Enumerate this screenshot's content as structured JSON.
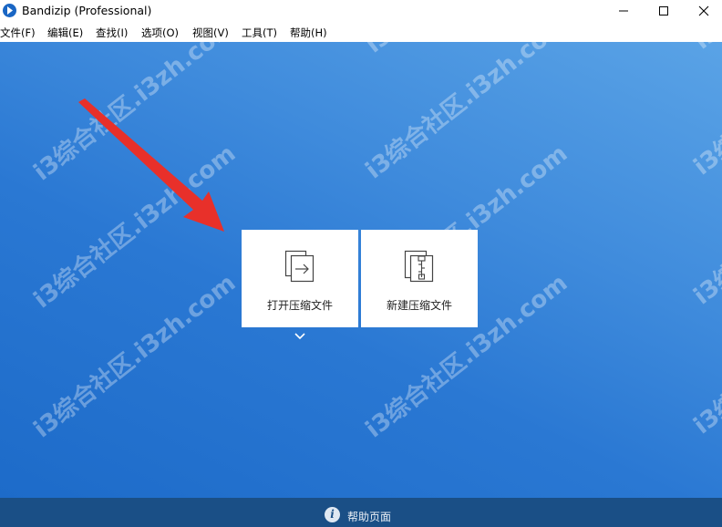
{
  "window": {
    "title": "Bandizip (Professional)",
    "app_icon": "bandizip-logo-icon",
    "controls": [
      "minimize-icon",
      "maximize-icon",
      "close-icon"
    ]
  },
  "menu": {
    "items": [
      {
        "label": "文件(F)"
      },
      {
        "label": "编辑(E)"
      },
      {
        "label": "查找(I)"
      },
      {
        "label": "选项(O)"
      },
      {
        "label": "视图(V)"
      },
      {
        "label": "工具(T)"
      },
      {
        "label": "帮助(H)"
      }
    ]
  },
  "tiles": {
    "open": {
      "label": "打开压缩文件",
      "icon": "open-archive-icon"
    },
    "new": {
      "label": "新建压缩文件",
      "icon": "new-archive-icon"
    }
  },
  "more_icon": "chevron-down-icon",
  "footer": {
    "label": "帮助页面",
    "icon": "info-icon"
  },
  "watermark": {
    "text": "i3综合社区.i3zh.com"
  },
  "colors": {
    "background_top": "#5aa3e6",
    "background_bottom": "#1d6bc9",
    "footer": "#1a4f86",
    "arrow": "#e8302a"
  }
}
